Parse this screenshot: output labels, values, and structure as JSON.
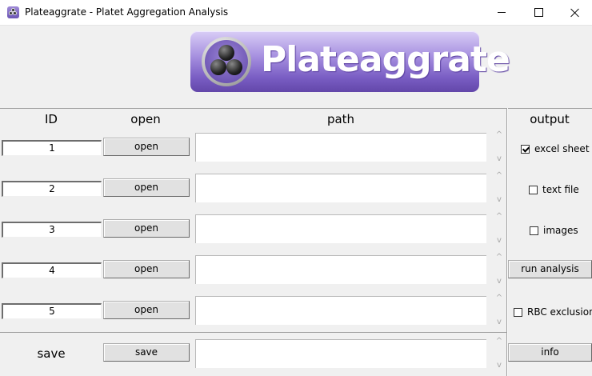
{
  "window": {
    "title": "Plateaggrate - Platet Aggregation Analysis",
    "icon": "plateaggrate-app-icon",
    "controls": [
      "minimize-icon",
      "maximize-icon",
      "close-icon"
    ]
  },
  "logo": {
    "text": "Plateaggrate",
    "icon": "three-platelets-sphere-icon"
  },
  "headers": {
    "id": "ID",
    "open": "open",
    "path": "path",
    "output": "output"
  },
  "rows": [
    {
      "id": "1",
      "open_label": "open",
      "path": ""
    },
    {
      "id": "2",
      "open_label": "open",
      "path": ""
    },
    {
      "id": "3",
      "open_label": "open",
      "path": ""
    },
    {
      "id": "4",
      "open_label": "open",
      "path": ""
    },
    {
      "id": "5",
      "open_label": "open",
      "path": ""
    }
  ],
  "output": {
    "excel_sheet": {
      "label": "excel sheet",
      "checked": true
    },
    "text_file": {
      "label": "text file",
      "checked": false
    },
    "images": {
      "label": "images",
      "checked": false
    },
    "run_analysis_label": "run analysis",
    "rbc_exclusion": {
      "label": "RBC exclusion",
      "checked": false
    },
    "info_label": "info"
  },
  "save_row": {
    "label": "save",
    "button_label": "save",
    "path": ""
  },
  "scroll_glyphs": {
    "up": "^",
    "down": "v"
  },
  "colors": {
    "logo_purple": "#7b5fc5",
    "window_bg": "#f0f0f0"
  }
}
